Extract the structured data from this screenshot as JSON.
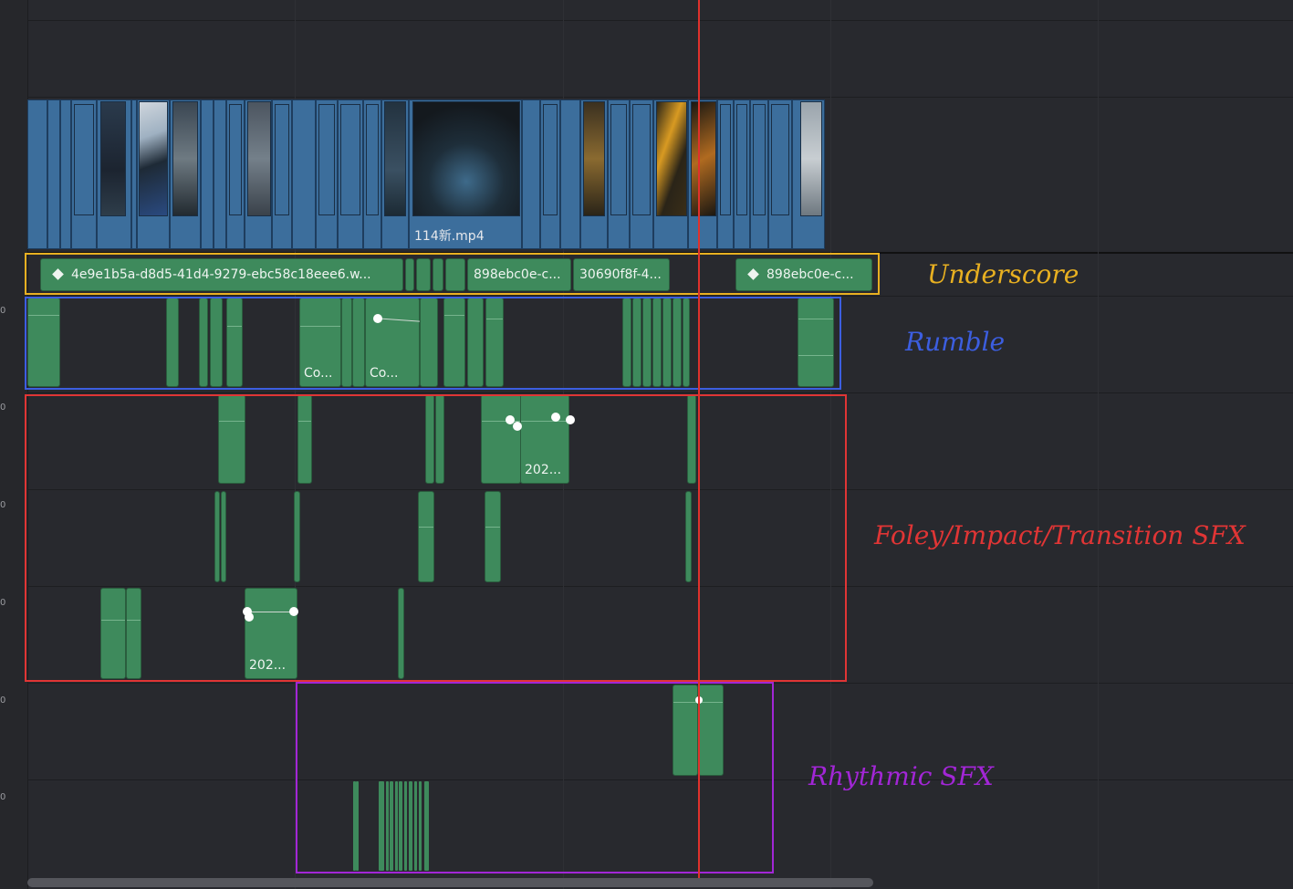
{
  "timeline": {
    "video_clip_label": "114新.mp4",
    "audio_clip_labels": {
      "rumble_1": "Co...",
      "rumble_2": "Co...",
      "foley_1": "202...",
      "foley_2": "202..."
    },
    "underscore_clips": [
      "4e9e1b5a-d8d5-41d4-9279-ebc58c18eee6.w...",
      "898ebc0e-c...",
      "30690f8f-4...",
      "898ebc0e-c..."
    ],
    "track_header_marks": [
      "0",
      "0",
      "0",
      "0",
      "0",
      "0"
    ]
  },
  "annotations": {
    "underscore": {
      "label": "Underscore",
      "color": "#e8b021"
    },
    "rumble": {
      "label": "Rumble",
      "color": "#3c5ee0"
    },
    "foley": {
      "label": "Foley/Impact/Transition SFX",
      "color": "#e03535"
    },
    "rhythmic": {
      "label": "Rhythmic SFX",
      "color": "#a226d6"
    }
  },
  "colors": {
    "video_clip": "#3c6e9c",
    "audio_clip": "#3e8a5c",
    "playhead": "#e0312c",
    "background": "#28292e"
  }
}
